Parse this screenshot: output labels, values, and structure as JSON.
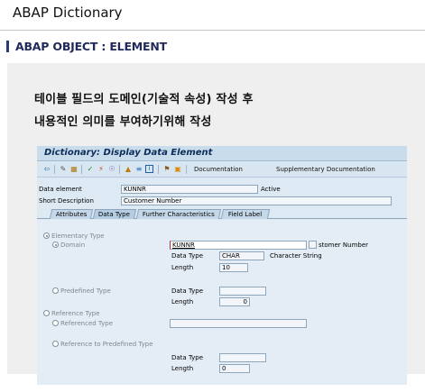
{
  "header": {
    "title": "ABAP Dictionary",
    "section_title": "ABAP OBJECT : ELEMENT"
  },
  "description": {
    "line1": "테이블 필드의 도메인(기술적 속성) 작성 후",
    "line2": "내용적인 의미를 부여하기위해 작성"
  },
  "sap_window": {
    "title": "Dictionary: Display Data Element",
    "toolbar": {
      "icons": [
        "back-arrow-icon",
        "display-change-icon",
        "other-object-icon",
        "check-icon",
        "activate-icon",
        "where-used-icon",
        "hierarchy-icon",
        "info-icon",
        "display-object-list-icon",
        "navigation-icon"
      ],
      "documentation_label": "Documentation",
      "supplementary_label": "Supplementary Documentation"
    },
    "header_fields": {
      "data_element_label": "Data element",
      "data_element_value": "KUNNR",
      "status": "Active",
      "short_description_label": "Short Description",
      "short_description_value": "Customer Number"
    },
    "tabs": [
      {
        "label": "Attributes",
        "active": false
      },
      {
        "label": "Data Type",
        "active": true
      },
      {
        "label": "Further Characteristics",
        "active": false
      },
      {
        "label": "Field Label",
        "active": false
      }
    ],
    "data_type_tab": {
      "elementary_type_label": "Elementary Type",
      "domain_label": "Domain",
      "domain_value": "KUNNR",
      "domain_description": "stomer Number",
      "data_type_label": "Data Type",
      "data_type_value": "CHAR",
      "data_type_description": "Character String",
      "length_label": "Length",
      "length_value": "10",
      "predefined_type_label": "Predefined Type",
      "predefined_data_type_label": "Data Type",
      "predefined_data_type_value": "",
      "predefined_length_label": "Length",
      "predefined_length_value": "0",
      "reference_type_label": "Reference Type",
      "referenced_type_label": "Referenced Type",
      "referenced_type_value": "",
      "reference_predefined_label": "Reference to Predefined Type",
      "ref_data_type_label": "Data Type",
      "ref_data_type_value": "",
      "ref_length_label": "Length",
      "ref_length_value": "0"
    }
  }
}
